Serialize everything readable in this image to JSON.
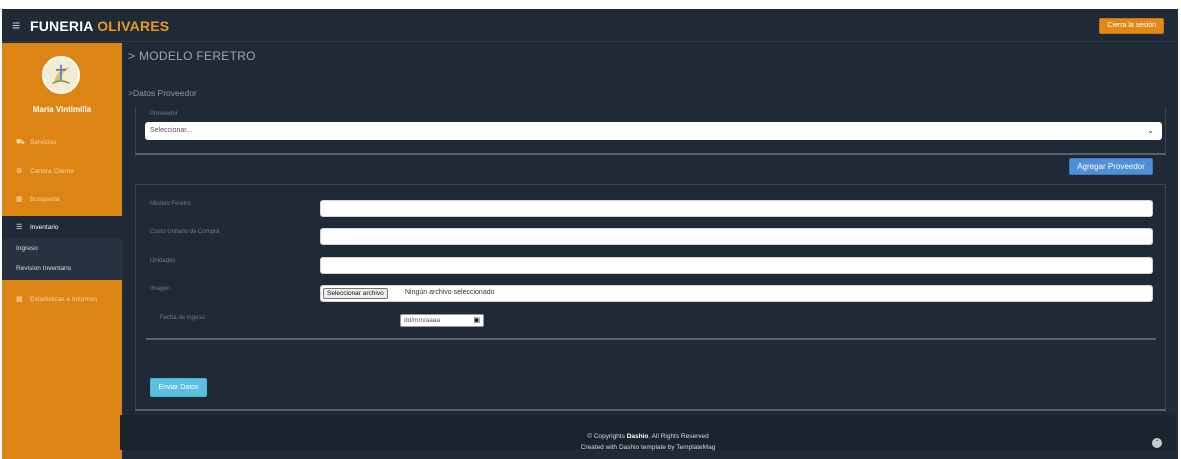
{
  "header": {
    "logo_white": "FUNERIA ",
    "logo_orange": "OLIVARES",
    "logout_label": "Cierra la sesión"
  },
  "sidebar": {
    "user_name": "Maria Vintimilla",
    "items": [
      {
        "label": "Servicios",
        "icon": "car-icon"
      },
      {
        "label": "Cartera Cliente",
        "icon": "cogs-icon"
      },
      {
        "label": "Busqueda",
        "icon": "grid-icon"
      },
      {
        "label": "Inventario",
        "icon": "list-icon"
      },
      {
        "label": "Estadisticas e Informes",
        "icon": "bar-chart-icon"
      }
    ],
    "sub_items": [
      {
        "label": "Ingreso"
      },
      {
        "label": "Revision Inventario"
      }
    ]
  },
  "main": {
    "title": "> MODELO FERETRO",
    "section": ">Datos Proveedor",
    "proveedor_label": "Proveedor",
    "select_value": "Seleccionar...",
    "add_provider_label": "Agregar Proveedor",
    "fields": {
      "modelo": "Modelo Feretro",
      "costo": "Costo Unitario de Compra",
      "unidades": "Unidades",
      "imagen": "Imagen",
      "fecha": "Fecha de Ingeso"
    },
    "file_button": "Seleccionar archivo",
    "file_status": "Ningún archivo seleccionado",
    "date_placeholder": "dd/mm/aaaa",
    "submit_label": "Enviar Datos"
  },
  "footer": {
    "line1_prefix": "© Copyrights ",
    "line1_brand": "Dashio",
    "line1_suffix": ". All Rights Reserved",
    "line2": "Created with Dashio template by TemplateMag"
  },
  "colors": {
    "sidebar": "#dc8514",
    "background": "#1f2a36",
    "accent_orange": "#e79a1e",
    "button_blue": "#4e8fd6",
    "button_send": "#5bc0de"
  }
}
